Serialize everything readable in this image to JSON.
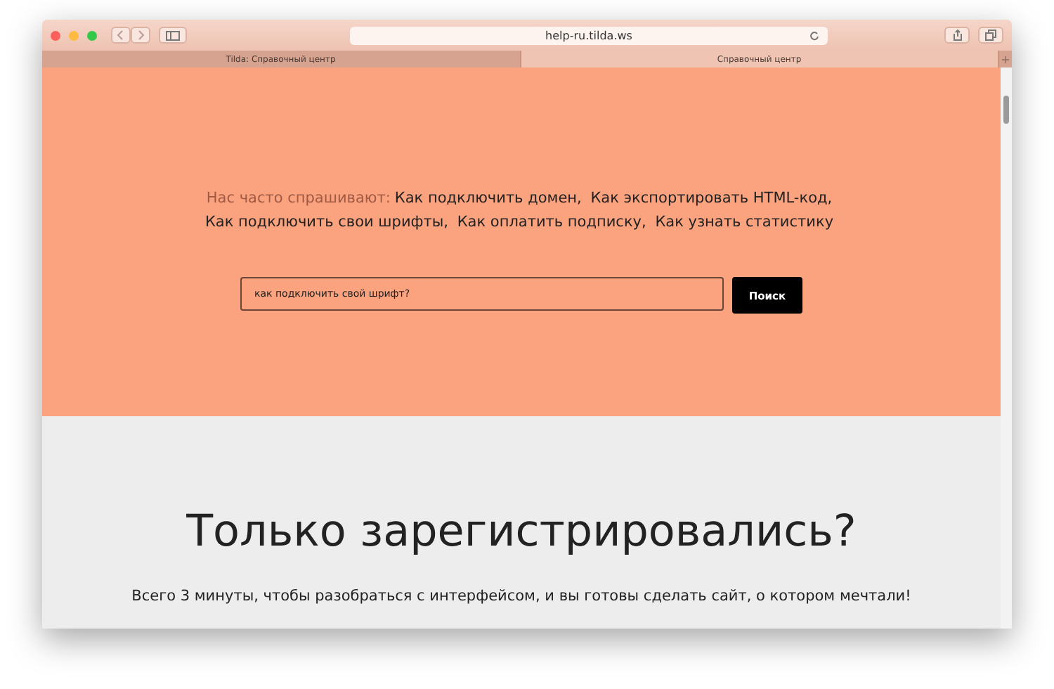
{
  "browser": {
    "url": "help-ru.tilda.ws",
    "tabs": [
      {
        "label": "Tilda: Справочный центр",
        "selected": false
      },
      {
        "label": "Справочный центр",
        "selected": true
      }
    ],
    "new_tab": "+"
  },
  "hero": {
    "faq_label": "Нас часто спрашивают:",
    "faq_links": [
      "Как подключить домен,",
      "Как экспортировать HTML-код,",
      "Как подключить свои шрифты,",
      "Как оплатить подписку,",
      "Как узнать статистику"
    ],
    "search": {
      "value": "как подключить свой шрифт?",
      "button": "Поиск"
    }
  },
  "intro": {
    "title": "Только зарегистрировались?",
    "subtitle": "Всего 3 минуты, чтобы разобраться с интерфейсом, и вы готовы сделать сайт, о котором мечтали!"
  }
}
